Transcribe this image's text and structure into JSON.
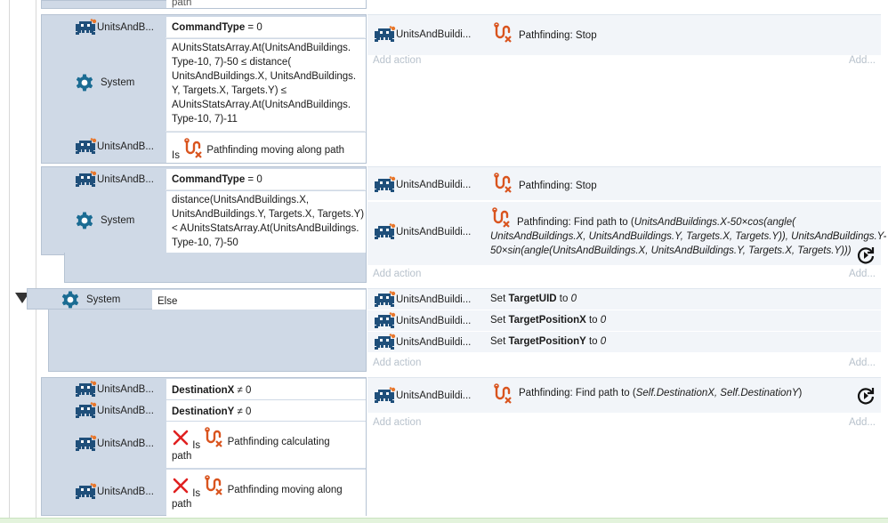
{
  "colors": {
    "block_bg": "#cfd9e6",
    "action_bg": "#f2f5f9",
    "add_text": "#b8c2cc",
    "pathfinding_icon": "#d9541e",
    "invader_icon": "#1f4f7a",
    "red_x": "#e02020",
    "footer_green": "#e3f3dc"
  },
  "icons": {
    "object": "space-invader-icon",
    "system": "gear-icon",
    "pathfinding": "pathfinding-icon",
    "inverted": "red-x-icon",
    "refresh": "refresh-icon"
  },
  "top_partial": {
    "text": "path"
  },
  "event1": {
    "c1_obj": "UnitsAndB...",
    "c1_text_bold": "CommandType",
    "c1_text_rest": " = 0",
    "c2_obj": "System",
    "c2_lines": [
      "AUnitsStatsArray.At(UnitsAndBuildings.",
      "Type-10, 7)-50 ≤ distance(",
      "UnitsAndBuildings.X, UnitsAndBuildings.",
      "Y, Targets.X, Targets.Y) ≤",
      "AUnitsStatsArray.At(UnitsAndBuildings.",
      "Type-10, 7)-11"
    ],
    "c3_obj": "UnitsAndB...",
    "c3_is": "Is",
    "c3_text": "Pathfinding moving along path",
    "a1_obj": "UnitsAndBuildi...",
    "a1_text": "Pathfinding: Stop",
    "add_action": "Add action",
    "add": "Add..."
  },
  "event2": {
    "c1_obj": "UnitsAndB...",
    "c1_text_bold": "CommandType",
    "c1_text_rest": " = 0",
    "c2_obj": "System",
    "c2_lines": [
      "distance(UnitsAndBuildings.X,",
      "UnitsAndBuildings.Y, Targets.X, Targets.Y)",
      "< AUnitsStatsArray.At(UnitsAndBuildings.",
      "Type-10, 7)-50"
    ],
    "a1_obj": "UnitsAndBuildi...",
    "a1_text": "Pathfinding: Stop",
    "a2_obj": "UnitsAndBuildi...",
    "a2_prefix": "Pathfinding: Find path to (",
    "a2_line1": "UnitsAndBuildings.X-50×cos(angle(",
    "a2_line2": "UnitsAndBuildings.X, UnitsAndBuildings.Y, Targets.X, Targets.Y)), UnitsAndBuildings.Y-",
    "a2_line3": "50×sin(angle(UnitsAndBuildings.X, UnitsAndBuildings.Y, Targets.X, Targets.Y)))",
    "add_action": "Add action",
    "add": "Add..."
  },
  "event3": {
    "c1_obj": "System",
    "c1_text": "Else",
    "actions": [
      {
        "obj": "UnitsAndBuildi...",
        "pre": "Set ",
        "bold": "TargetUID",
        "post": " to ",
        "val": "0"
      },
      {
        "obj": "UnitsAndBuildi...",
        "pre": "Set ",
        "bold": "TargetPositionX",
        "post": " to ",
        "val": "0"
      },
      {
        "obj": "UnitsAndBuildi...",
        "pre": "Set ",
        "bold": "TargetPositionY",
        "post": " to ",
        "val": "0"
      }
    ],
    "add_action": "Add action",
    "add": "Add..."
  },
  "event4": {
    "c1_obj": "UnitsAndB...",
    "c1_bold": "DestinationX",
    "c1_rest": " ≠ 0",
    "c2_obj": "UnitsAndB...",
    "c2_bold": "DestinationY",
    "c2_rest": " ≠ 0",
    "c3_obj": "UnitsAndB...",
    "c3_is": "Is",
    "c3_text": "Pathfinding calculating",
    "c3_text2": "path",
    "c4_obj": "UnitsAndB...",
    "c4_is": "Is",
    "c4_text": "Pathfinding moving along",
    "c4_text2": "path",
    "a1_obj": "UnitsAndBuildi...",
    "a1_prefix": "Pathfinding: Find path to (",
    "a1_args": "Self.DestinationX, Self.DestinationY",
    "a1_suffix": ")",
    "add_action": "Add action",
    "add": "Add..."
  }
}
